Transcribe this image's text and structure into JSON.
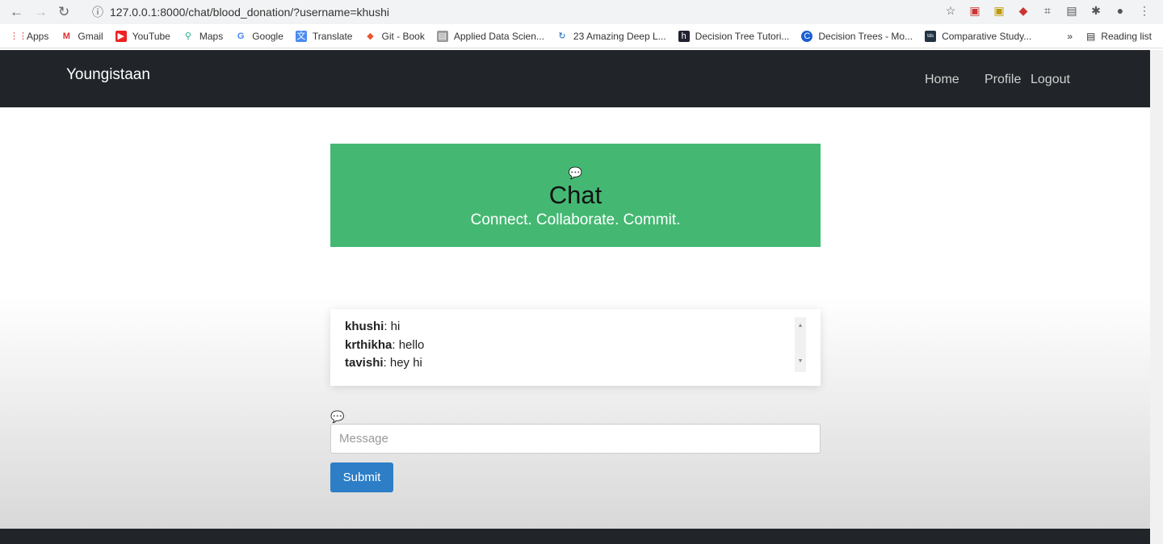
{
  "browser": {
    "url": "127.0.0.1:8000/chat/blood_donation/?username=khushi",
    "bookmarks": [
      "Apps",
      "Gmail",
      "YouTube",
      "Maps",
      "Google",
      "Translate",
      "Git - Book",
      "Applied Data Scien...",
      "23 Amazing Deep L...",
      "Decision Tree Tutori...",
      "Decision Trees - Mo...",
      "Comparative Study..."
    ],
    "more": "»",
    "reading_list": "Reading list"
  },
  "navbar": {
    "brand": "Youngistaan",
    "links": [
      "Home",
      "Profile",
      "Logout"
    ]
  },
  "hero": {
    "title": "Chat",
    "subtitle": "Connect. Collaborate. Commit.",
    "color": "#44b873"
  },
  "messages": [
    {
      "user": "khushi",
      "text": ": hi"
    },
    {
      "user": "krthikha",
      "text": ": hello"
    },
    {
      "user": "tavishi",
      "text": ": hey hi"
    }
  ],
  "form": {
    "placeholder": "Message",
    "value": "",
    "submit": "Submit"
  }
}
